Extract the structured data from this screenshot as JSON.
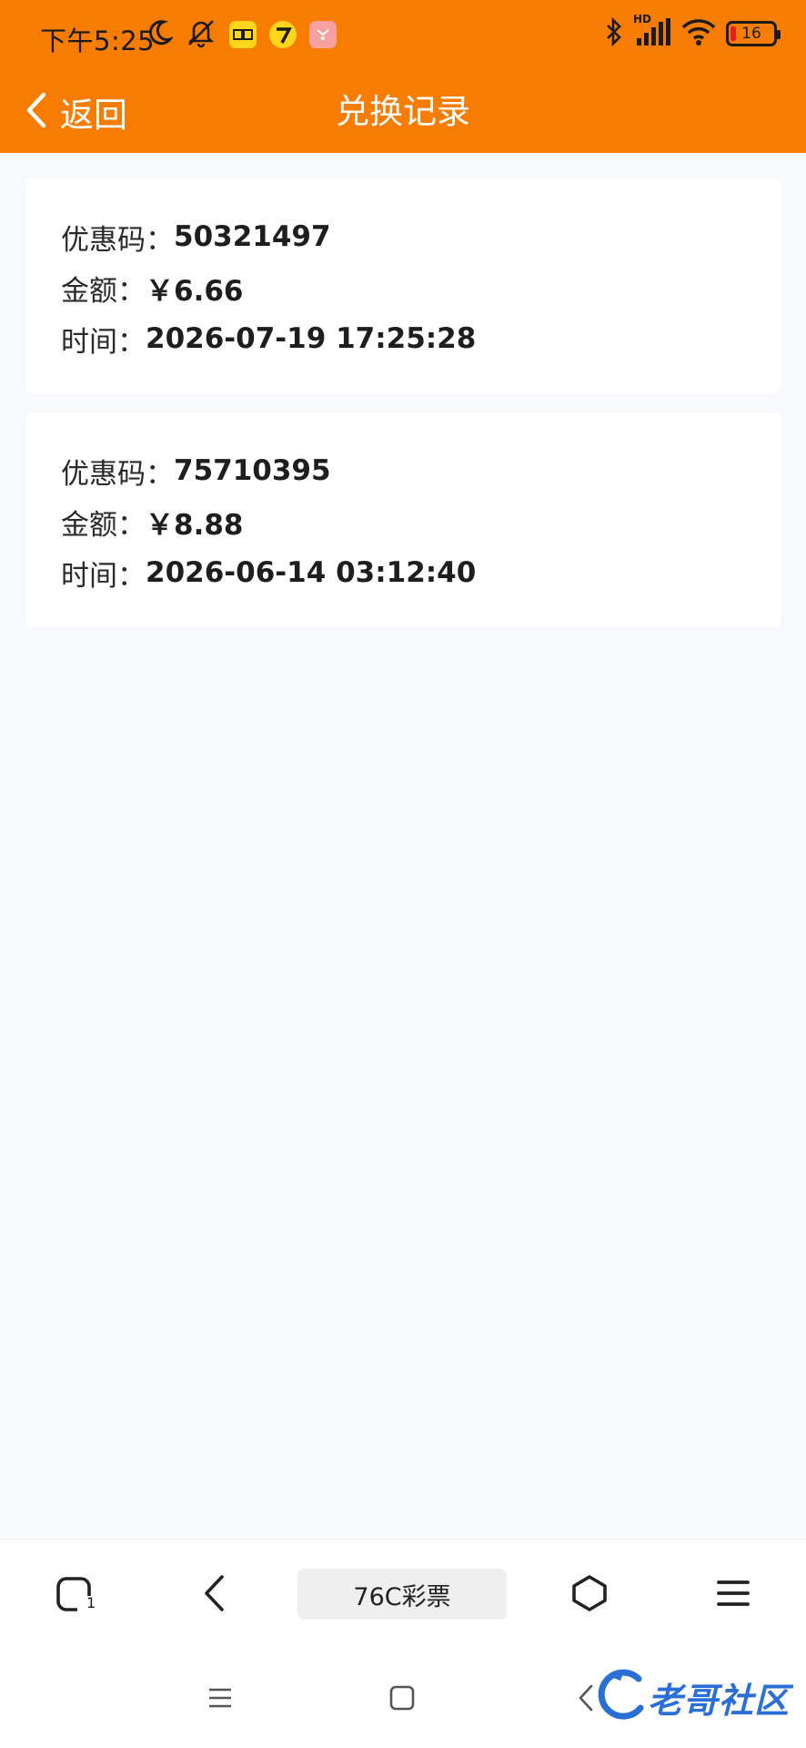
{
  "status_bar": {
    "time": "下午5:25",
    "battery_level": "16",
    "hd_label": "HD",
    "accent_color": "#f77c02",
    "icons": [
      "moon-icon",
      "mute-icon",
      "app-badge-yellow-icon",
      "app-badge-bird-icon",
      "app-badge-pink-icon",
      "bluetooth-icon",
      "signal-icon",
      "wifi-icon",
      "battery-icon"
    ]
  },
  "header": {
    "back_label": "返回",
    "title": "兑换记录"
  },
  "records": [
    {
      "code_label": "优惠码：",
      "code": "50321497",
      "amount_label": "金额：",
      "amount": "￥6.66",
      "time_label": "时间：",
      "time": "2026-07-19 17:25:28"
    },
    {
      "code_label": "优惠码：",
      "code": "75710395",
      "amount_label": "金额：",
      "amount": "￥8.88",
      "time_label": "时间：",
      "time": "2026-06-14 03:12:40"
    }
  ],
  "browser_bar": {
    "tab_count": "1",
    "url_title": "76C彩票"
  },
  "watermark": {
    "text": "老哥社区"
  }
}
